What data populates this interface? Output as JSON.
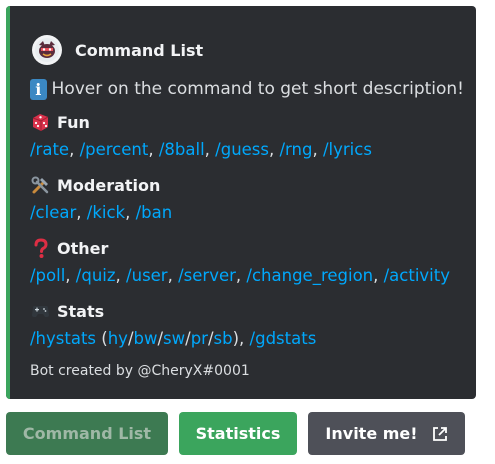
{
  "embed": {
    "accent_color": "#3ba55d",
    "author": {
      "name": "Command List",
      "icon": "bot-avatar-icon"
    },
    "description": {
      "icon": "info-icon",
      "icon_glyph": "i",
      "text": "Hover on the command to get short description!"
    },
    "fields": [
      {
        "icon": "dice-icon",
        "title": "Fun",
        "commands": [
          "/rate",
          "/percent",
          "/8ball",
          "/guess",
          "/rng",
          "/lyrics"
        ]
      },
      {
        "icon": "tools-icon",
        "title": "Moderation",
        "commands": [
          "/clear",
          "/kick",
          "/ban"
        ]
      },
      {
        "icon": "question-mark-icon",
        "title": "Other",
        "commands": [
          "/poll",
          "/quiz",
          "/user",
          "/server",
          "/change_region",
          "/activity"
        ]
      },
      {
        "icon": "gamepad-icon",
        "title": "Stats",
        "hystats": "/hystats",
        "hystats_modes": [
          "hy",
          "bw",
          "sw",
          "pr",
          "sb"
        ],
        "gdstats": "/gdstats"
      }
    ],
    "footer": "Bot created by @CheryX#0001"
  },
  "buttons": {
    "command_list": {
      "label": "Command List",
      "disabled": true
    },
    "statistics": {
      "label": "Statistics"
    },
    "invite": {
      "label": "Invite me!",
      "icon": "external-link-icon"
    }
  }
}
